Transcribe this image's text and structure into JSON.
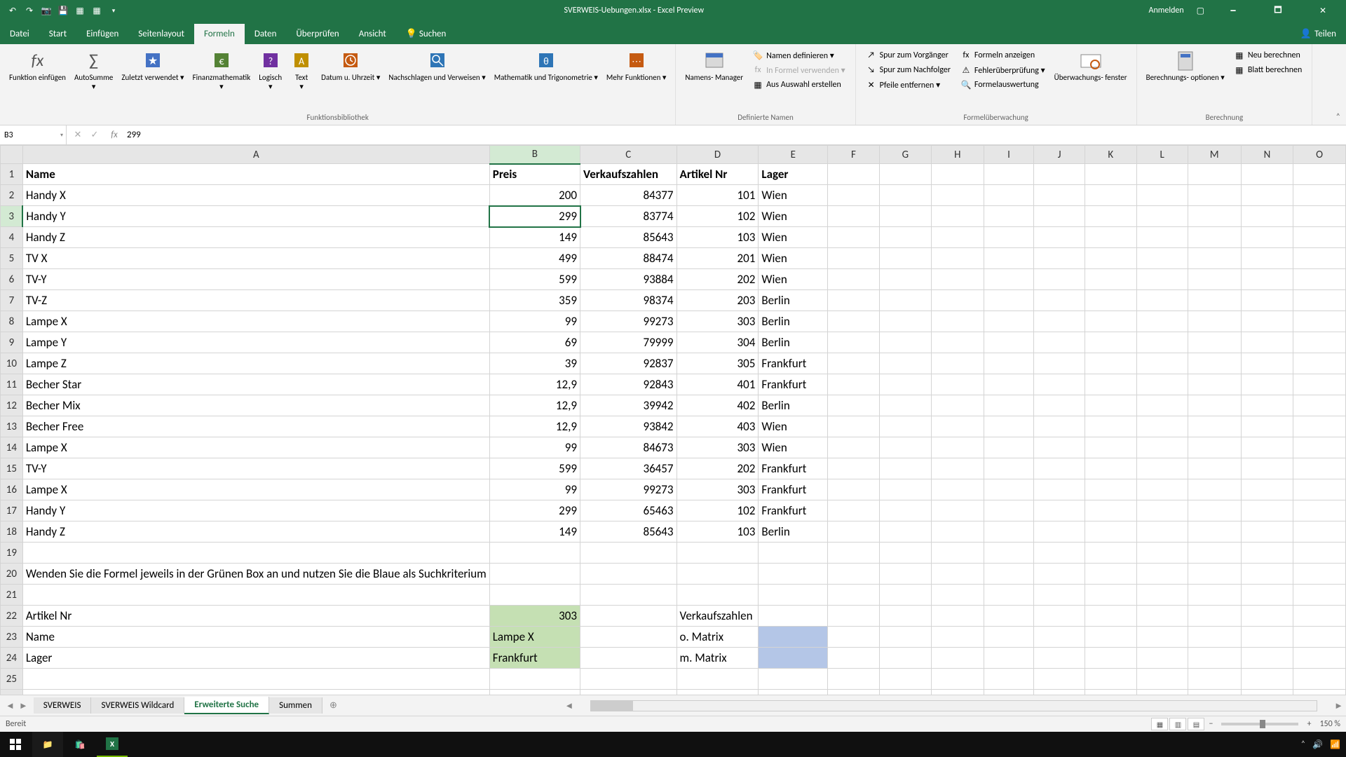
{
  "titlebar": {
    "title": "SVERWEIS-Uebungen.xlsx - Excel Preview",
    "signin": "Anmelden"
  },
  "tabs": {
    "datei": "Datei",
    "start": "Start",
    "einfuegen": "Einfügen",
    "seitenlayout": "Seitenlayout",
    "formeln": "Formeln",
    "daten": "Daten",
    "ueberpruefen": "Überprüfen",
    "ansicht": "Ansicht",
    "suchen": "Suchen",
    "teilen": "Teilen"
  },
  "ribbon": {
    "funktion_einfuegen": "Funktion\neinfügen",
    "autosumme": "AutoSumme",
    "zuletzt": "Zuletzt\nverwendet ▾",
    "finanz": "Finanzmathematik",
    "logisch": "Logisch",
    "text": "Text",
    "datum": "Datum u.\nUhrzeit ▾",
    "nachschlagen": "Nachschlagen\nund Verweisen ▾",
    "mathe": "Mathematik und\nTrigonometrie ▾",
    "mehr": "Mehr\nFunktionen ▾",
    "grp_funktionsbib": "Funktionsbibliothek",
    "namens_manager": "Namens-\nManager",
    "namen_definieren": "Namen definieren ▾",
    "in_formel": "In Formel verwenden ▾",
    "aus_auswahl": "Aus Auswahl erstellen",
    "grp_def_namen": "Definierte Namen",
    "spur_vorg": "Spur zum Vorgänger",
    "spur_nachf": "Spur zum Nachfolger",
    "pfeile_entf": "Pfeile entfernen ▾",
    "formeln_anzeigen": "Formeln anzeigen",
    "fehler": "Fehlerüberprüfung ▾",
    "formelauswertung": "Formelauswertung",
    "grp_formeluw": "Formelüberwachung",
    "ueberwachung": "Überwachungs-\nfenster",
    "berechnungs_opt": "Berechnungs-\noptionen ▾",
    "neu_berechnen": "Neu berechnen",
    "blatt_berechnen": "Blatt berechnen",
    "grp_berechnung": "Berechnung"
  },
  "formula_bar": {
    "cell_ref": "B3",
    "formula": "299"
  },
  "columns": [
    "A",
    "B",
    "C",
    "D",
    "E",
    "F",
    "G",
    "H",
    "I",
    "J",
    "K",
    "L",
    "M",
    "N",
    "O"
  ],
  "headers": {
    "name": "Name",
    "preis": "Preis",
    "verkaufszahlen": "Verkaufszahlen",
    "artikel_nr": "Artikel Nr",
    "lager": "Lager"
  },
  "rows": [
    {
      "r": 2,
      "name": "Handy X",
      "preis": "200",
      "verk": "84377",
      "art": "101",
      "lager": "Wien"
    },
    {
      "r": 3,
      "name": "Handy Y",
      "preis": "299",
      "verk": "83774",
      "art": "102",
      "lager": "Wien"
    },
    {
      "r": 4,
      "name": "Handy Z",
      "preis": "149",
      "verk": "85643",
      "art": "103",
      "lager": "Wien"
    },
    {
      "r": 5,
      "name": "TV X",
      "preis": "499",
      "verk": "88474",
      "art": "201",
      "lager": "Wien"
    },
    {
      "r": 6,
      "name": "TV-Y",
      "preis": "599",
      "verk": "93884",
      "art": "202",
      "lager": "Wien"
    },
    {
      "r": 7,
      "name": "TV-Z",
      "preis": "359",
      "verk": "98374",
      "art": "203",
      "lager": "Berlin"
    },
    {
      "r": 8,
      "name": "Lampe X",
      "preis": "99",
      "verk": "99273",
      "art": "303",
      "lager": "Berlin"
    },
    {
      "r": 9,
      "name": "Lampe Y",
      "preis": "69",
      "verk": "79999",
      "art": "304",
      "lager": "Berlin"
    },
    {
      "r": 10,
      "name": "Lampe Z",
      "preis": "39",
      "verk": "92837",
      "art": "305",
      "lager": "Frankfurt"
    },
    {
      "r": 11,
      "name": "Becher Star",
      "preis": "12,9",
      "verk": "92843",
      "art": "401",
      "lager": "Frankfurt"
    },
    {
      "r": 12,
      "name": "Becher Mix",
      "preis": "12,9",
      "verk": "39942",
      "art": "402",
      "lager": "Berlin"
    },
    {
      "r": 13,
      "name": "Becher Free",
      "preis": "12,9",
      "verk": "93842",
      "art": "403",
      "lager": "Wien"
    },
    {
      "r": 14,
      "name": "Lampe X",
      "preis": "99",
      "verk": "84673",
      "art": "303",
      "lager": "Wien"
    },
    {
      "r": 15,
      "name": "TV-Y",
      "preis": "599",
      "verk": "36457",
      "art": "202",
      "lager": "Frankfurt"
    },
    {
      "r": 16,
      "name": "Lampe X",
      "preis": "99",
      "verk": "99273",
      "art": "303",
      "lager": "Frankfurt"
    },
    {
      "r": 17,
      "name": "Handy Y",
      "preis": "299",
      "verk": "65463",
      "art": "102",
      "lager": "Frankfurt"
    },
    {
      "r": 18,
      "name": "Handy Z",
      "preis": "149",
      "verk": "85643",
      "art": "103",
      "lager": "Berlin"
    }
  ],
  "instruction_row": {
    "r": 20,
    "text": "Wenden Sie die Formel jeweils in der Grünen Box an und nutzen Sie die Blaue als Suchkriterium"
  },
  "lookup": {
    "r22_a": "Artikel Nr",
    "r22_b": "303",
    "r22_d": "Verkaufszahlen",
    "r23_a": "Name",
    "r23_b": "Lampe X",
    "r23_d": "o. Matrix",
    "r24_a": "Lager",
    "r24_b": "Frankfurt",
    "r24_d": "m. Matrix"
  },
  "sheets": {
    "s1": "SVERWEIS",
    "s2": "SVERWEIS Wildcard",
    "s3": "Erweiterte Suche",
    "s4": "Summen"
  },
  "status": {
    "ready": "Bereit",
    "zoom": "150 %"
  }
}
